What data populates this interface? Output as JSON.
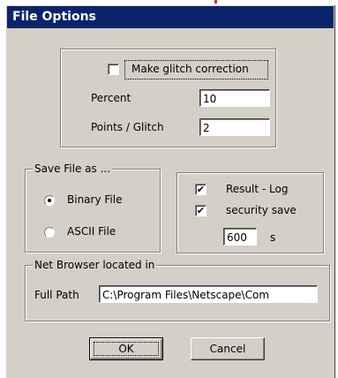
{
  "window": {
    "title": "File Options"
  },
  "glitch": {
    "make_glitch_correction_label": "Make glitch correction",
    "make_glitch_correction_checked": false,
    "percent_label": "Percent",
    "percent_value": "10",
    "points_per_glitch_label": "Points / Glitch",
    "points_per_glitch_value": "2"
  },
  "save_file": {
    "legend": "Save File as ...",
    "binary_label": "Binary File",
    "ascii_label": "ASCII  File",
    "selected": "binary"
  },
  "logging": {
    "result_log_label": "Result - Log",
    "result_log_checked": true,
    "security_save_label": "security save",
    "security_save_checked": true,
    "interval_value": "600",
    "interval_unit": "s"
  },
  "net_browser": {
    "legend": "Net Browser located in",
    "full_path_label": "Full Path",
    "full_path_value": "C:\\Program Files\\Netscape\\Com"
  },
  "buttons": {
    "ok": "OK",
    "cancel": "Cancel"
  },
  "check_mark": "✔"
}
